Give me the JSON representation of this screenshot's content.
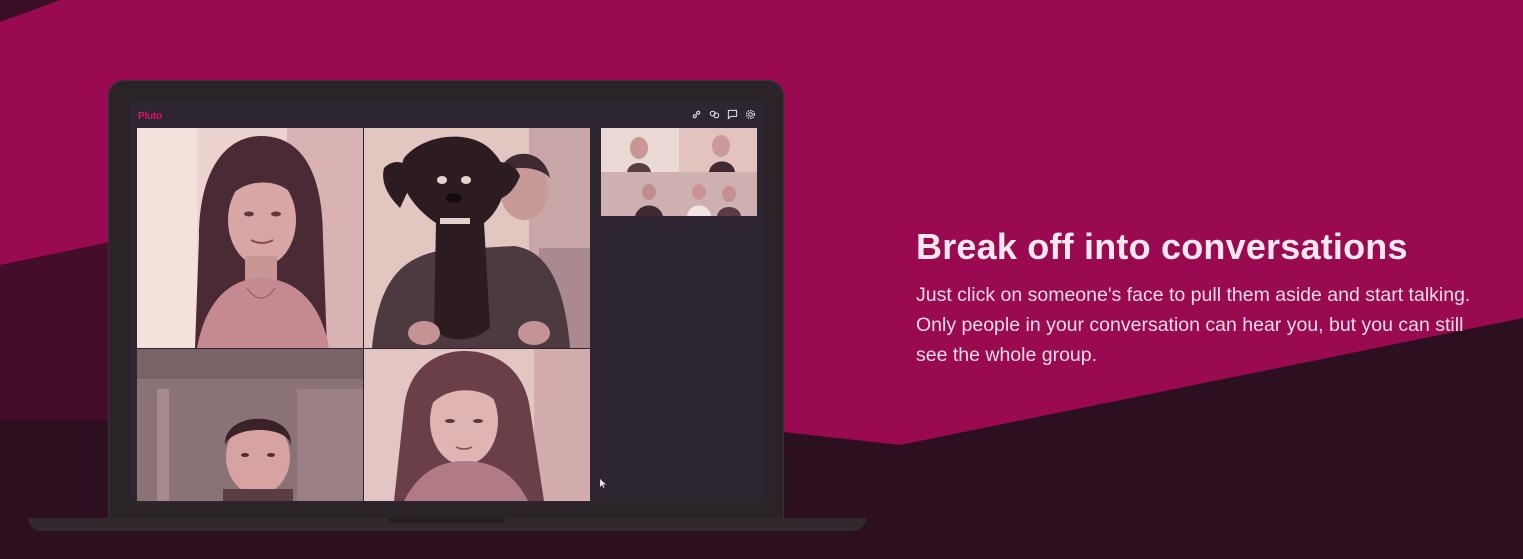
{
  "hero": {
    "headline": "Break off into conversations",
    "description": "Just click on someone's face to pull them aside and start talking. Only people in your conversation can hear you, but you can still see the whole group."
  },
  "app": {
    "logo_text": "Pluto",
    "toolbar": [
      {
        "name": "link-icon"
      },
      {
        "name": "group-icon"
      },
      {
        "name": "chat-icon"
      },
      {
        "name": "settings-icon"
      }
    ]
  },
  "video_grid": {
    "participants": [
      "woman-long-hair",
      "man-with-dog",
      "man-short-hair",
      "girl-long-hair"
    ]
  },
  "side_group": {
    "participant_count": 5
  },
  "colors": {
    "background": "#990a51",
    "dark_wave": "#2c1020",
    "laptop": "#2a2328",
    "logo_accent": "#e0136a",
    "headline": "#fbe8ef"
  }
}
